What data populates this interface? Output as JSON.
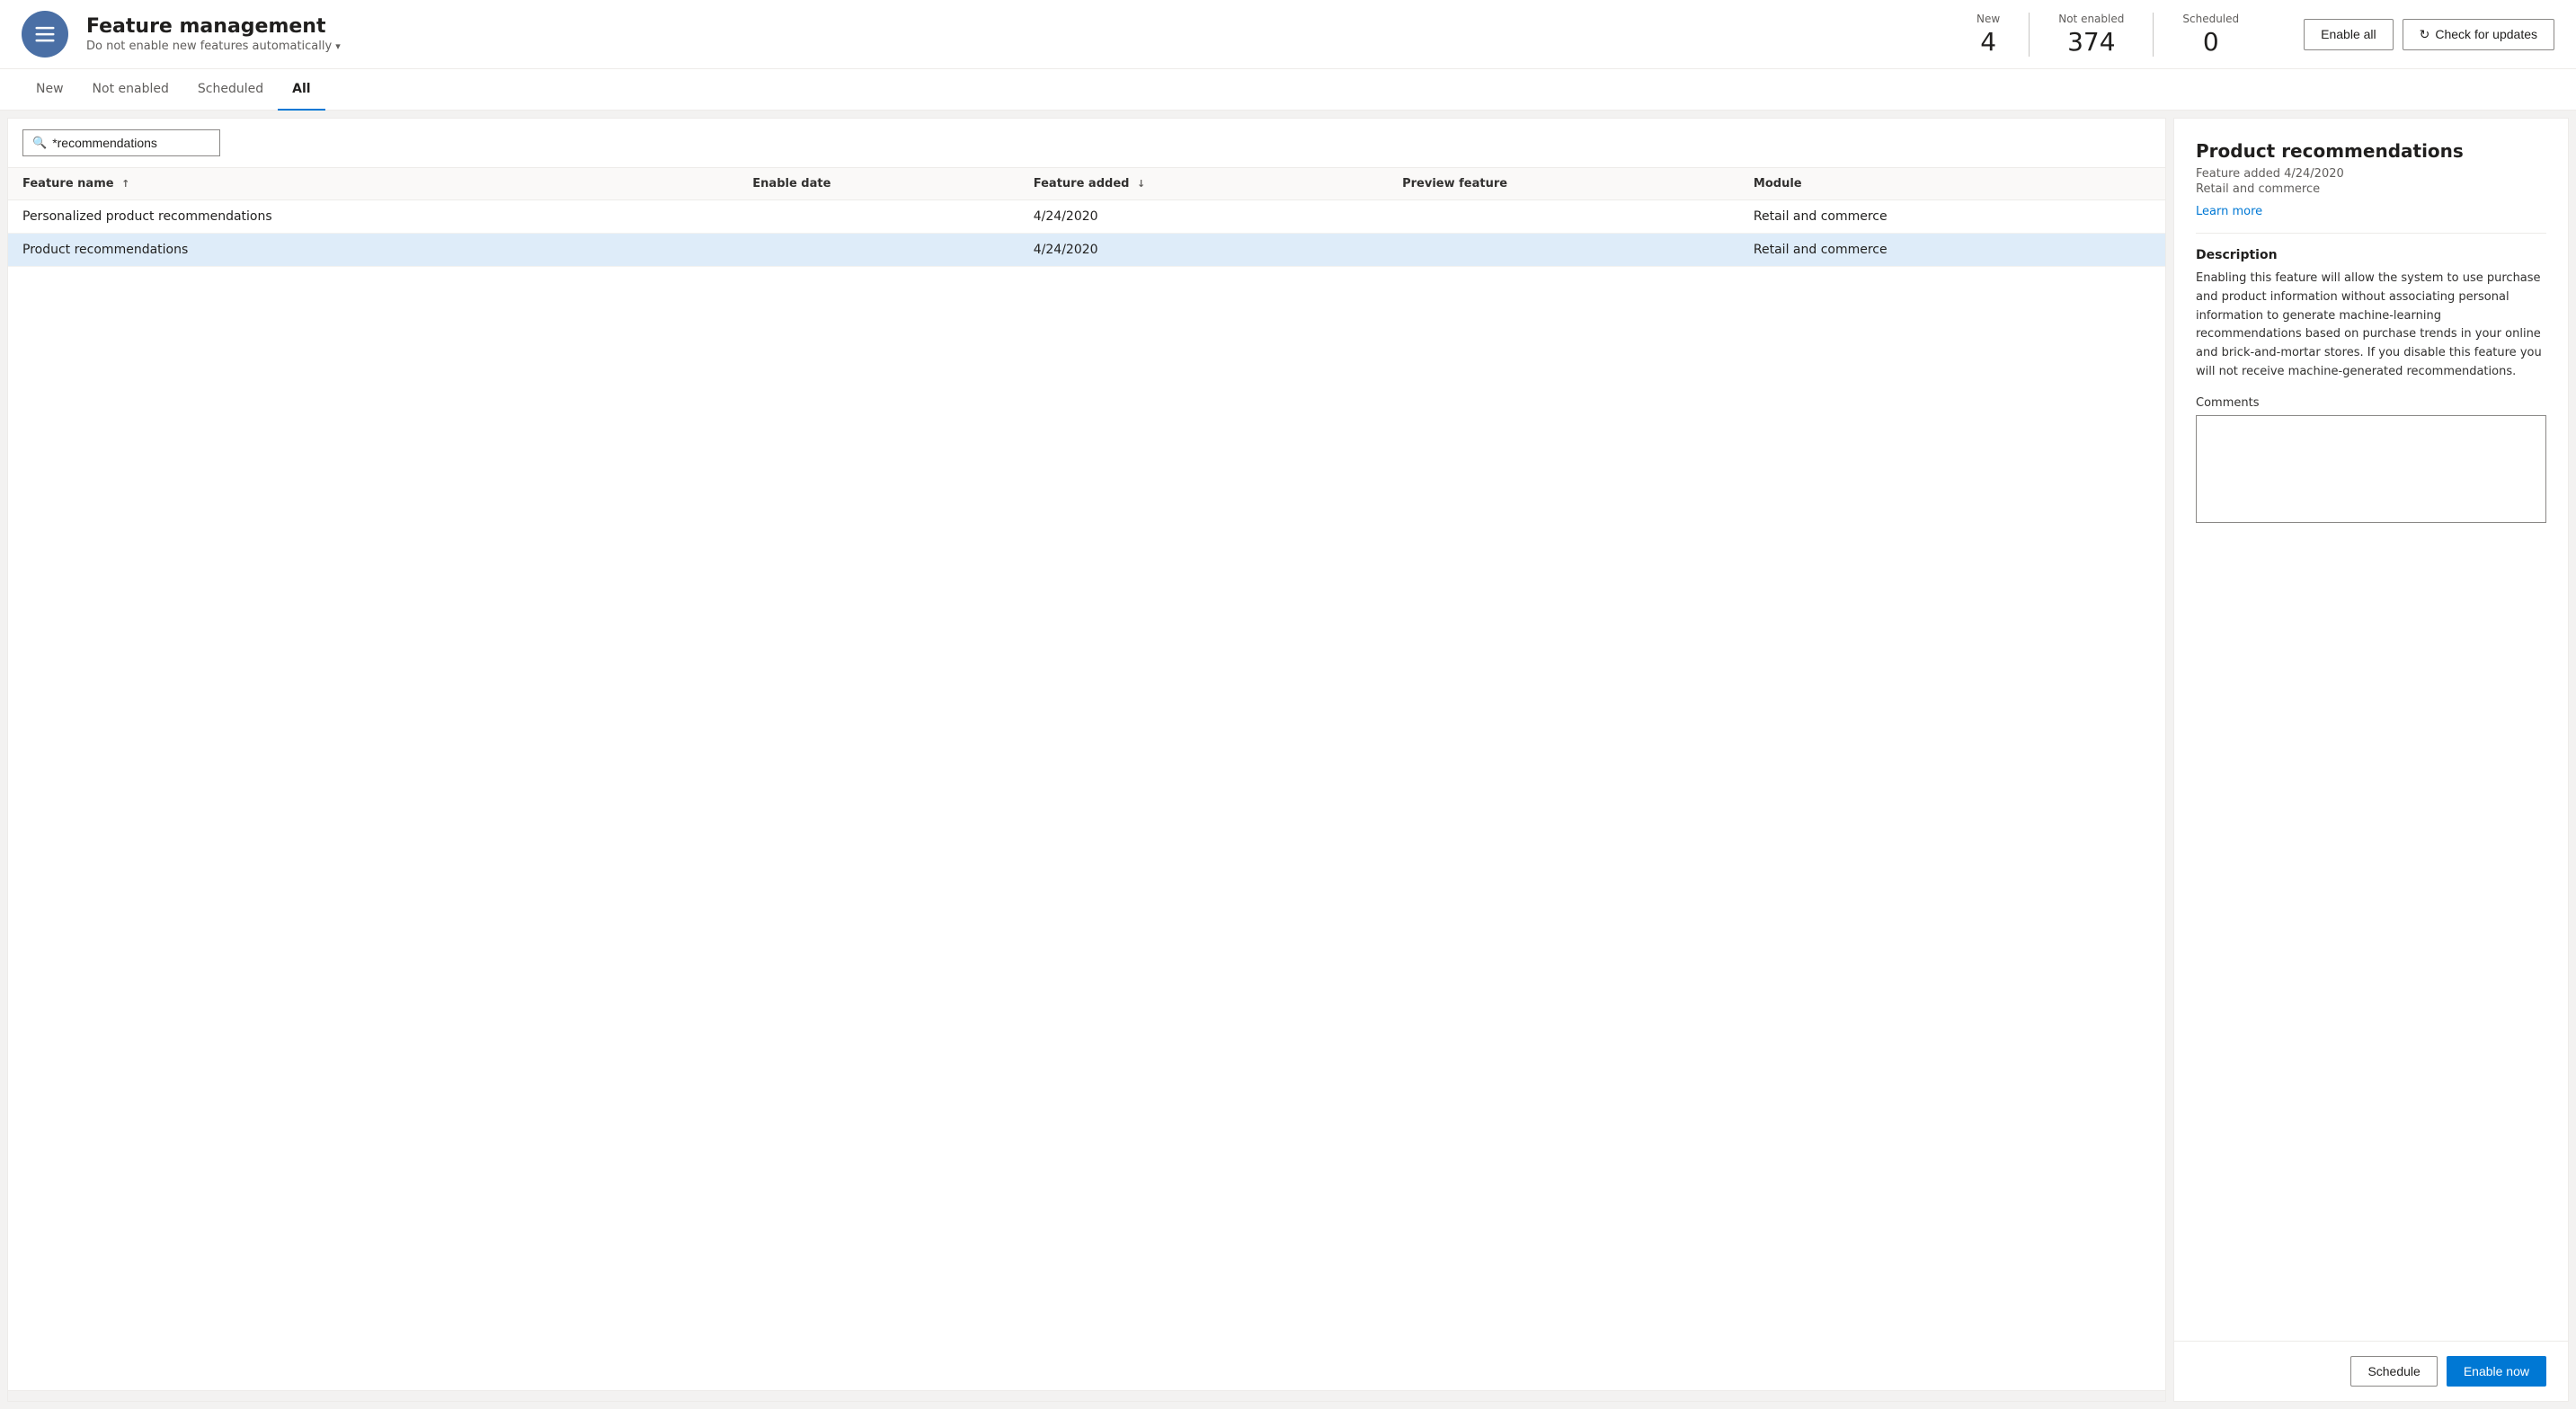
{
  "header": {
    "title": "Feature management",
    "subtitle": "Do not enable new features automatically",
    "stats": {
      "new_label": "New",
      "new_value": "4",
      "not_enabled_label": "Not enabled",
      "not_enabled_value": "374",
      "scheduled_label": "Scheduled",
      "scheduled_value": "0"
    },
    "enable_all_label": "Enable all",
    "check_updates_label": "Check for updates"
  },
  "tabs": [
    {
      "id": "new",
      "label": "New"
    },
    {
      "id": "not-enabled",
      "label": "Not enabled"
    },
    {
      "id": "scheduled",
      "label": "Scheduled"
    },
    {
      "id": "all",
      "label": "All",
      "active": true
    }
  ],
  "search": {
    "value": "*recommendations",
    "placeholder": "Search"
  },
  "table": {
    "columns": [
      {
        "id": "feature-name",
        "label": "Feature name",
        "sort": "asc"
      },
      {
        "id": "enable-date",
        "label": "Enable date"
      },
      {
        "id": "feature-added",
        "label": "Feature added",
        "sort": "desc"
      },
      {
        "id": "preview-feature",
        "label": "Preview feature"
      },
      {
        "id": "module",
        "label": "Module"
      }
    ],
    "rows": [
      {
        "id": "personalized-product-recommendations",
        "feature_name": "Personalized product recommendations",
        "enable_date": "",
        "feature_added": "4/24/2020",
        "preview_feature": "",
        "module": "Retail and commerce",
        "selected": false
      },
      {
        "id": "product-recommendations",
        "feature_name": "Product recommendations",
        "enable_date": "",
        "feature_added": "4/24/2020",
        "preview_feature": "",
        "module": "Retail and commerce",
        "selected": true
      }
    ]
  },
  "detail_panel": {
    "title": "Product recommendations",
    "meta_added": "Feature added 4/24/2020",
    "meta_module": "Retail and commerce",
    "learn_more_label": "Learn more",
    "description_title": "Description",
    "description": "Enabling this feature will allow the system to use purchase and product information without associating personal information to generate machine-learning recommendations based on purchase trends in your online and brick-and-mortar stores. If you disable this feature you will not receive machine-generated recommendations.",
    "comments_label": "Comments",
    "schedule_label": "Schedule",
    "enable_now_label": "Enable now"
  }
}
